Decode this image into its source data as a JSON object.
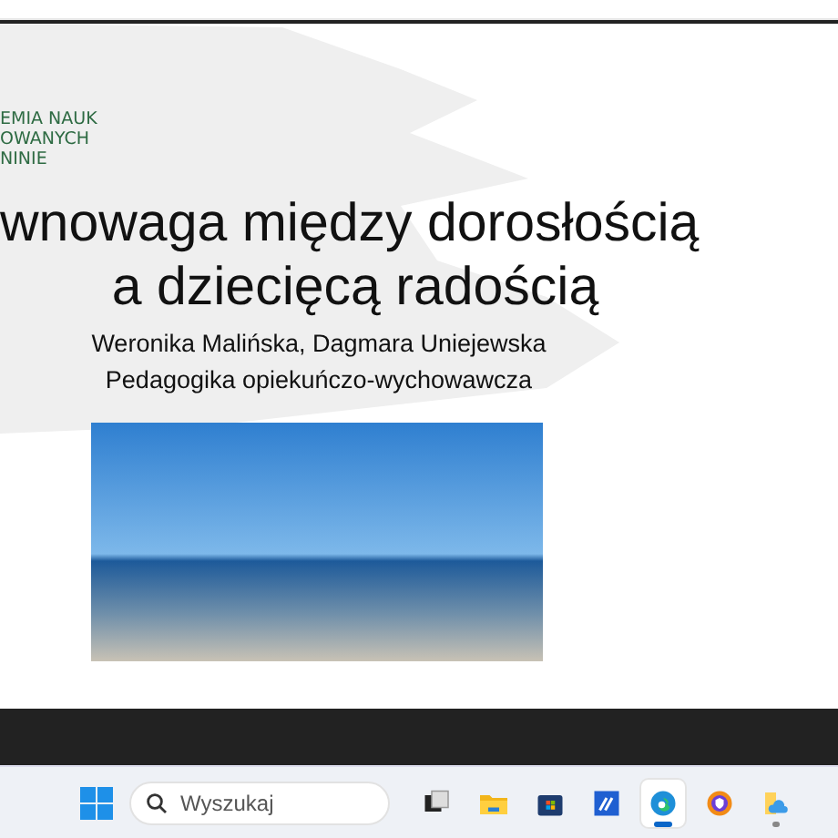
{
  "slide": {
    "logo_lines": [
      "EMIA NAUK",
      "OWANYCH",
      "NINIE"
    ],
    "title_lines": [
      "wnowaga między dorosłością",
      "a dziecięcą radością"
    ],
    "authors": "Weronika Malińska, Dagmara Uniejewska",
    "subtitle": "Pedagogika opiekuńczo-wychowawcza"
  },
  "taskbar": {
    "search": {
      "placeholder": "Wyszukaj"
    },
    "apps": [
      {
        "kind": "taskview",
        "selected": false,
        "running": false
      },
      {
        "kind": "folder",
        "selected": false,
        "running": false
      },
      {
        "kind": "store",
        "selected": false,
        "running": false
      },
      {
        "kind": "editor",
        "selected": false,
        "running": false
      },
      {
        "kind": "edge",
        "selected": true,
        "running": true
      },
      {
        "kind": "shield",
        "selected": false,
        "running": false
      },
      {
        "kind": "cloudfolder",
        "selected": false,
        "running": true
      }
    ]
  }
}
